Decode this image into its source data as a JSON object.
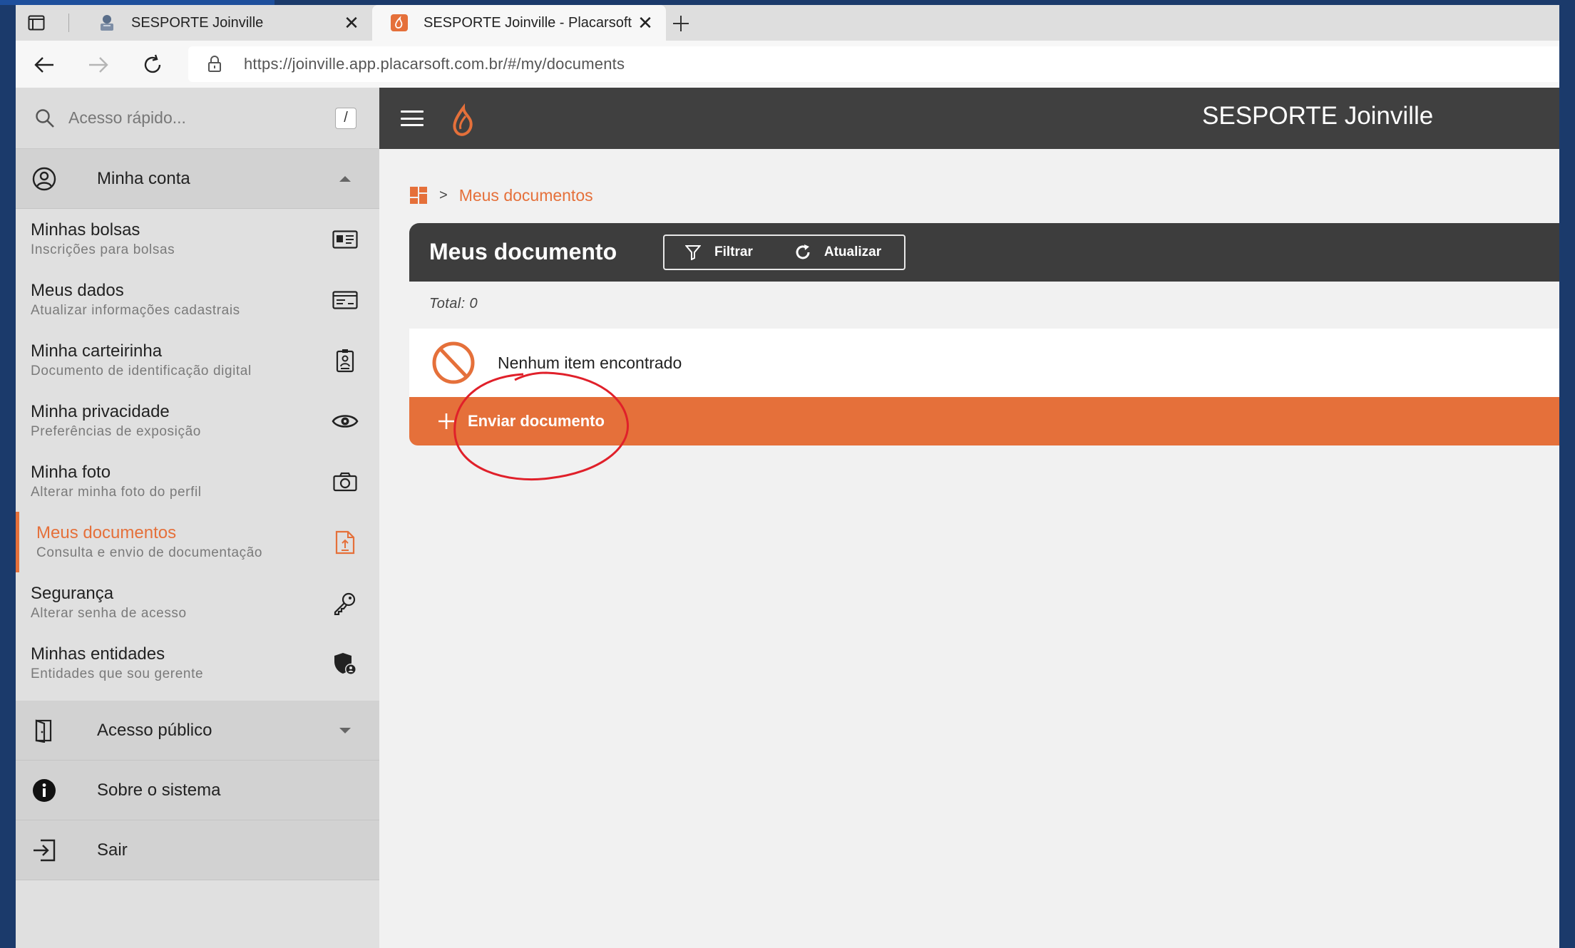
{
  "browser": {
    "tabs": [
      {
        "title": "SESPORTE Joinville"
      },
      {
        "title": "SESPORTE Joinville - Placarsoft"
      }
    ],
    "url": "https://joinville.app.placarsoft.com.br/#/my/documents"
  },
  "sidebar": {
    "search": {
      "placeholder": "Acesso rápido...",
      "shortcut": "/"
    },
    "account_section": {
      "label": "Minha conta"
    },
    "items": [
      {
        "title": "Minhas bolsas",
        "subtitle": "Inscrições para bolsas",
        "icon": "id-card-icon"
      },
      {
        "title": "Meus dados",
        "subtitle": "Atualizar informações cadastrais",
        "icon": "profile-card-icon"
      },
      {
        "title": "Minha carteirinha",
        "subtitle": "Documento de identificação digital",
        "icon": "badge-icon"
      },
      {
        "title": "Minha privacidade",
        "subtitle": "Preferências de exposição",
        "icon": "eye-icon"
      },
      {
        "title": "Minha foto",
        "subtitle": "Alterar minha foto do perfil",
        "icon": "camera-icon"
      },
      {
        "title": "Meus documentos",
        "subtitle": "Consulta e envio de documentação",
        "icon": "file-upload-icon",
        "active": true
      },
      {
        "title": "Segurança",
        "subtitle": "Alterar senha de acesso",
        "icon": "key-icon"
      },
      {
        "title": "Minhas entidades",
        "subtitle": "Entidades que sou gerente",
        "icon": "shield-user-icon"
      }
    ],
    "public_section": {
      "label": "Acesso público"
    },
    "about": {
      "label": "Sobre o sistema"
    },
    "logout": {
      "label": "Sair"
    }
  },
  "header": {
    "app_title": "SESPORTE Joinville"
  },
  "breadcrumb": {
    "separator": ">",
    "current": "Meus documentos"
  },
  "documents": {
    "title": "Meus documento",
    "filter_label": "Filtrar",
    "refresh_label": "Atualizar",
    "total": "Total: 0",
    "empty_message": "Nenhum item encontrado",
    "send_label": "Enviar documento"
  },
  "colors": {
    "accent": "#e5703a",
    "topbar": "#404040",
    "sidebar": "#e0e0e0",
    "annotation": "#e0202a"
  }
}
